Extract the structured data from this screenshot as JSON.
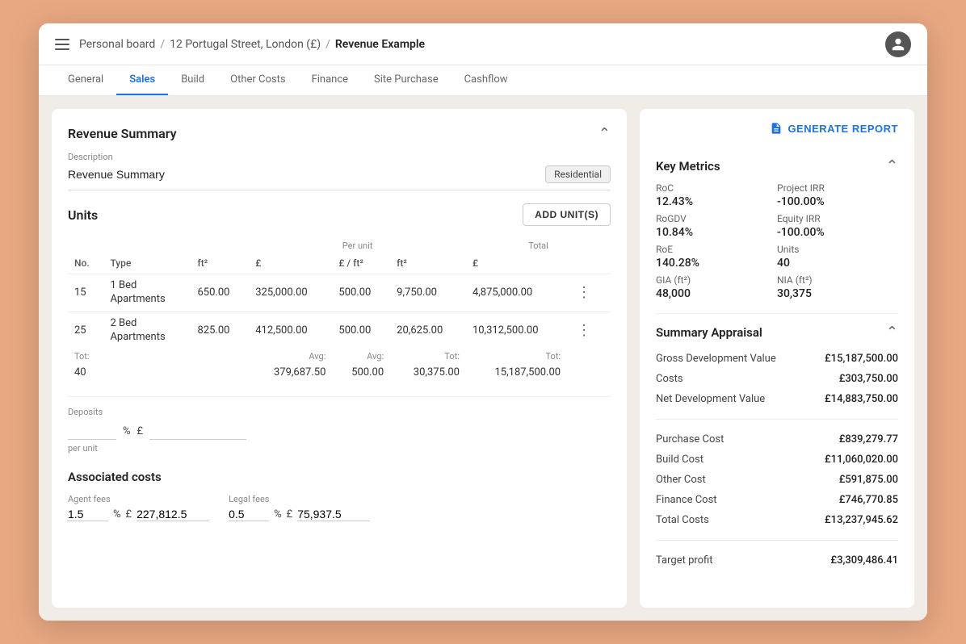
{
  "window": {
    "breadcrumb": {
      "board": "Personal board",
      "sep1": "/",
      "project": "12 Portugal Street, London (£)",
      "sep2": "/",
      "current": "Revenue Example"
    }
  },
  "tabs": [
    {
      "label": "General",
      "active": false
    },
    {
      "label": "Sales",
      "active": true
    },
    {
      "label": "Build",
      "active": false
    },
    {
      "label": "Other Costs",
      "active": false
    },
    {
      "label": "Finance",
      "active": false
    },
    {
      "label": "Site Purchase",
      "active": false
    },
    {
      "label": "Cashflow",
      "active": false
    }
  ],
  "left": {
    "section_title": "Revenue Summary",
    "description_label": "Description",
    "description_value": "Revenue Summary",
    "badge": "Residential",
    "units_title": "Units",
    "add_unit_btn": "ADD UNIT(S)",
    "table": {
      "col_group_per_unit": "Per unit",
      "col_group_total": "Total",
      "headers": [
        "No.",
        "Type",
        "ft²",
        "£",
        "£ / ft²",
        "ft²",
        "£"
      ],
      "rows": [
        {
          "no": "15",
          "type": "1 Bed\nApartments",
          "ft2": "650.00",
          "gbp": "325,000.00",
          "gbp_ft2": "500.00",
          "total_ft2": "9,750.00",
          "total_gbp": "4,875,000.00"
        },
        {
          "no": "25",
          "type": "2 Bed\nApartments",
          "ft2": "825.00",
          "gbp": "412,500.00",
          "gbp_ft2": "500.00",
          "total_ft2": "20,625.00",
          "total_gbp": "10,312,500.00"
        }
      ],
      "footer": {
        "tot_label": "Tot:",
        "tot_no": "40",
        "avg_label_gbp": "Avg:",
        "avg_gbp": "379,687.50",
        "avg_label_ft2": "Avg:",
        "avg_ft2": "500.00",
        "tot_label_ft2": "Tot:",
        "tot_ft2": "30,375.00",
        "tot_label_total": "Tot:",
        "tot_total": "15,187,500.00"
      }
    },
    "deposits_label": "Deposits",
    "deposits_pct": "",
    "deposits_val": "",
    "deposits_per_unit": "per unit",
    "assoc_title": "Associated costs",
    "agent_fees_label": "Agent fees",
    "agent_fees_pct": "1.5",
    "agent_fees_sym": "%",
    "agent_fees_currency": "£",
    "agent_fees_value": "227,812.5",
    "legal_fees_label": "Legal fees",
    "legal_fees_pct": "0.5",
    "legal_fees_sym": "%",
    "legal_fees_currency": "£",
    "legal_fees_value": "75,937.5"
  },
  "right": {
    "generate_btn": "GENERATE REPORT",
    "key_metrics_title": "Key Metrics",
    "metrics": [
      {
        "label": "RoC",
        "value": "12.43%"
      },
      {
        "label": "Project IRR",
        "value": "-100.00%"
      },
      {
        "label": "RoGDV",
        "value": "10.84%"
      },
      {
        "label": "Equity IRR",
        "value": "-100.00%"
      },
      {
        "label": "RoE",
        "value": "140.28%"
      },
      {
        "label": "Units",
        "value": "40"
      },
      {
        "label": "GIA (ft²)",
        "value": "48,000"
      },
      {
        "label": "NIA (ft²)",
        "value": "30,375"
      }
    ],
    "summary_title": "Summary Appraisal",
    "summary_rows": [
      {
        "label": "Gross Development Value",
        "value": "£15,187,500.00"
      },
      {
        "label": "Costs",
        "value": "£303,750.00"
      },
      {
        "label": "Net Development Value",
        "value": "£14,883,750.00"
      },
      {
        "label": "Purchase Cost",
        "value": "£839,279.77"
      },
      {
        "label": "Build Cost",
        "value": "£11,060,020.00"
      },
      {
        "label": "Other Cost",
        "value": "£591,875.00"
      },
      {
        "label": "Finance Cost",
        "value": "£746,770.85"
      },
      {
        "label": "Total Costs",
        "value": "£13,237,945.62"
      },
      {
        "label": "Target profit",
        "value": "£3,309,486.41"
      }
    ]
  }
}
